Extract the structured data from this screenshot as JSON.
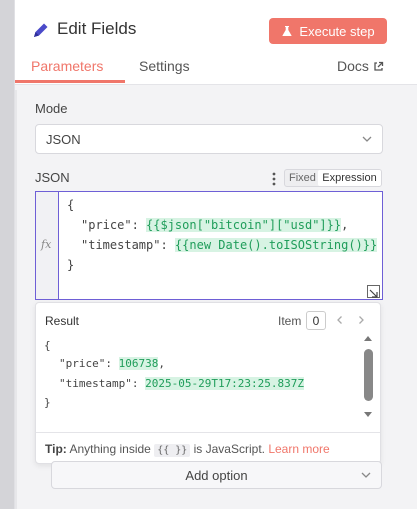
{
  "header": {
    "title": "Edit Fields",
    "execute_label": "Execute step",
    "tabs": [
      "Parameters",
      "Settings"
    ],
    "docs_label": "Docs"
  },
  "mode": {
    "label": "Mode",
    "value": "JSON"
  },
  "json_field": {
    "label": "JSON",
    "toggle_fixed": "Fixed",
    "toggle_expression": "Expression",
    "fx": "fx",
    "lines": {
      "open": "{",
      "price_key": "\"price\": ",
      "price_expr": "{{$json[\"bitcoin\"][\"usd\"]}}",
      "price_suffix": ",",
      "ts_key": "\"timestamp\": ",
      "ts_expr": "{{new Date().toISOString()}}",
      "close": "}"
    }
  },
  "result": {
    "title": "Result",
    "item_label": "Item",
    "item_index": "0",
    "lines": {
      "open": "{",
      "price_key": "\"price\": ",
      "price_value": "106738",
      "price_suffix": ",",
      "ts_key": "\"timestamp\": ",
      "ts_value": "2025-05-29T17:23:25.837Z",
      "close": "}"
    },
    "tip_label": "Tip:",
    "tip_text": " Anything inside ",
    "tip_code": "{{ }}",
    "tip_text2": " is JavaScript. ",
    "learn_more": "Learn more"
  },
  "add_option_label": "Add option",
  "colors": {
    "accent": "#f0766a",
    "expression_border": "#6e5fd6",
    "highlight_bg": "#d7f3e3",
    "highlight_text": "#1f9d5a"
  }
}
